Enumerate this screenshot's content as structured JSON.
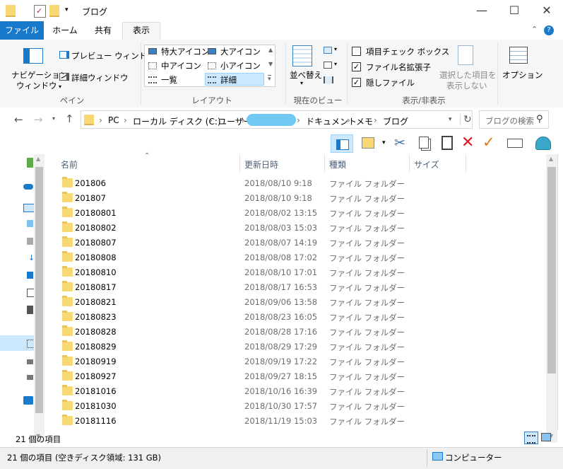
{
  "titlebar": {
    "title": "ブログ",
    "minimize": "—",
    "maximize": "☐",
    "close": "✕"
  },
  "tabs": [
    {
      "label": "ファイル"
    },
    {
      "label": "ホーム"
    },
    {
      "label": "共有"
    },
    {
      "label": "表示"
    }
  ],
  "ribbon": {
    "pane_group": {
      "nav_pane_label_1": "ナビゲーション",
      "nav_pane_label_2": "ウィンドウ",
      "preview_label": "プレビュー ウィンドウ",
      "details_label": "詳細ウィンドウ",
      "group_label": "ペイン"
    },
    "layout_group": {
      "xl_icons": "特大アイコン",
      "l_icons": "大アイコン",
      "m_icons": "中アイコン",
      "s_icons": "小アイコン",
      "list": "一覧",
      "details": "詳細",
      "group_label": "レイアウト"
    },
    "current_view_group": {
      "sort_label_1": "並べ替え",
      "group_label": "現在のビュー"
    },
    "show_hide_group": {
      "item_checkbox": "項目チェック ボックス",
      "item_checkbox_checked": false,
      "file_ext": "ファイル名拡張子",
      "file_ext_checked": true,
      "hidden_files": "隠しファイル",
      "hidden_files_checked": true,
      "hide_selected_1": "選択した項目を",
      "hide_selected_2": "表示しない",
      "group_label": "表示/非表示"
    },
    "options_label": "オプション"
  },
  "address": {
    "crumbs": [
      "PC",
      "ローカル ディスク (C:)",
      "ユーザー",
      "ドキュメント",
      "メモ",
      "ブログ"
    ],
    "search_placeholder": "ブログの検索"
  },
  "columns": {
    "name": "名前",
    "date": "更新日時",
    "type": "種類",
    "size": "サイズ"
  },
  "files": [
    {
      "name": "201806",
      "date": "2018/08/10 9:18",
      "type": "ファイル フォルダー"
    },
    {
      "name": "201807",
      "date": "2018/08/10 9:18",
      "type": "ファイル フォルダー"
    },
    {
      "name": "20180801",
      "date": "2018/08/02 13:15",
      "type": "ファイル フォルダー"
    },
    {
      "name": "20180802",
      "date": "2018/08/03 15:03",
      "type": "ファイル フォルダー"
    },
    {
      "name": "20180807",
      "date": "2018/08/07 14:19",
      "type": "ファイル フォルダー"
    },
    {
      "name": "20180808",
      "date": "2018/08/08 17:02",
      "type": "ファイル フォルダー"
    },
    {
      "name": "20180810",
      "date": "2018/08/10 17:01",
      "type": "ファイル フォルダー"
    },
    {
      "name": "20180817",
      "date": "2018/08/17 16:53",
      "type": "ファイル フォルダー"
    },
    {
      "name": "20180821",
      "date": "2018/09/06 13:58",
      "type": "ファイル フォルダー"
    },
    {
      "name": "20180823",
      "date": "2018/08/23 16:05",
      "type": "ファイル フォルダー"
    },
    {
      "name": "20180828",
      "date": "2018/08/28 17:16",
      "type": "ファイル フォルダー"
    },
    {
      "name": "20180829",
      "date": "2018/08/29 17:29",
      "type": "ファイル フォルダー"
    },
    {
      "name": "20180919",
      "date": "2018/09/19 17:22",
      "type": "ファイル フォルダー"
    },
    {
      "name": "20180927",
      "date": "2018/09/27 18:15",
      "type": "ファイル フォルダー"
    },
    {
      "name": "20181016",
      "date": "2018/10/16 16:39",
      "type": "ファイル フォルダー"
    },
    {
      "name": "20181030",
      "date": "2018/10/30 17:57",
      "type": "ファイル フォルダー"
    },
    {
      "name": "20181116",
      "date": "2018/11/19 15:03",
      "type": "ファイル フォルダー"
    }
  ],
  "status": {
    "item_count": "21 個の項目",
    "bottom": "21 個の項目 (空きディスク領域: 131 GB)",
    "computer": "コンピューター"
  },
  "colors": {
    "accent": "#1979ca",
    "folder": "#f8d775",
    "delete": "#e81123",
    "check": "#e07b1a"
  }
}
